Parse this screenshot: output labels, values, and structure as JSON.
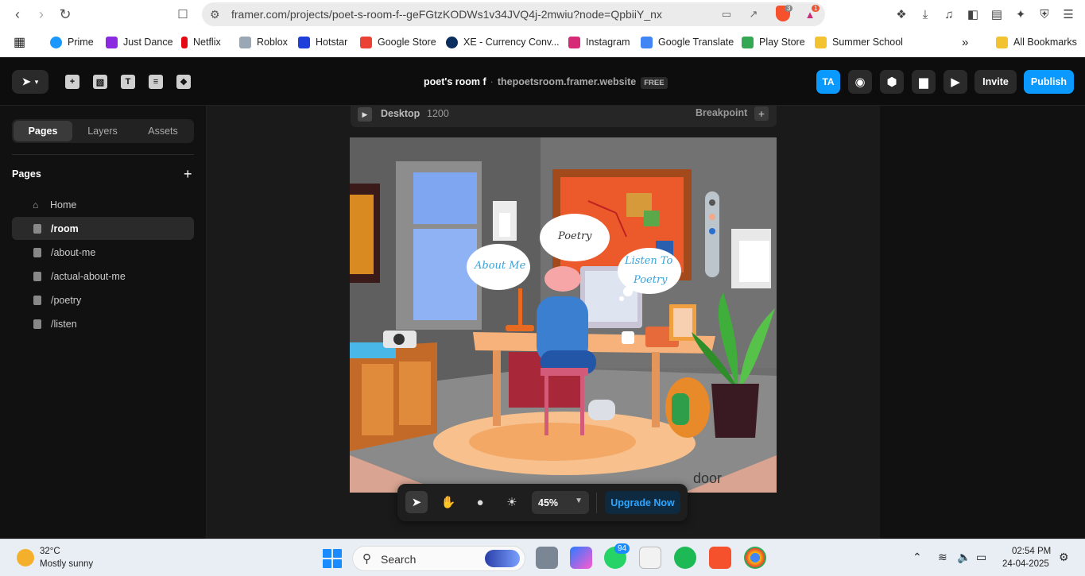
{
  "browser": {
    "url": "framer.com/projects/poet-s-room-f--geFGtzKODWs1v34JVQ4j-2mwiu?node=QpbiiY_nx",
    "brave_badge": "3",
    "alert_badge": "1",
    "bookmarks": [
      {
        "label": "Prime",
        "color": "#1a98ff"
      },
      {
        "label": "Just Dance",
        "color": "#8a2be2"
      },
      {
        "label": "Netflix",
        "color": "#e50914"
      },
      {
        "label": "Roblox",
        "color": "#9aa7b5"
      },
      {
        "label": "Hotstar",
        "color": "#1f3fdb"
      },
      {
        "label": "Google Store",
        "color": "#ea4335"
      },
      {
        "label": "XE - Currency Conv...",
        "color": "#0b2e5f"
      },
      {
        "label": "Instagram",
        "color": "#d62976"
      },
      {
        "label": "Google Translate",
        "color": "#4285f4"
      },
      {
        "label": "Play Store",
        "color": "#34a853"
      },
      {
        "label": "Summer School",
        "color": "#f2c230"
      }
    ],
    "all_bookmarks": "All Bookmarks"
  },
  "framer": {
    "project_name": "poet's room f",
    "site": "thepoetsroom.framer.website",
    "plan": "FREE",
    "avatar": "TA",
    "invite": "Invite",
    "publish": "Publish"
  },
  "left_panel": {
    "tabs": [
      "Pages",
      "Layers",
      "Assets"
    ],
    "active_tab": "Pages",
    "heading": "Pages",
    "pages": [
      {
        "label": "Home",
        "icon": "home-icon"
      },
      {
        "label": "/room",
        "icon": "page-icon"
      },
      {
        "label": "/about-me",
        "icon": "page-icon"
      },
      {
        "label": "/actual-about-me",
        "icon": "page-icon"
      },
      {
        "label": "/poetry",
        "icon": "page-icon"
      },
      {
        "label": "/listen",
        "icon": "page-icon"
      }
    ],
    "active_page": "/room"
  },
  "canvas": {
    "breakpoint_label": "Desktop",
    "breakpoint_width": "1200",
    "breakpoint_button": "Breakpoint",
    "bubbles": {
      "about": "About Me",
      "poetry": "Poetry",
      "listen_1": "Listen To",
      "listen_2": "Poetry"
    },
    "door_label": "door"
  },
  "bottom_toolbar": {
    "zoom": "45%",
    "upgrade": "Upgrade Now"
  },
  "taskbar": {
    "temperature": "32°C",
    "weather": "Mostly sunny",
    "search": "Search",
    "whatsapp_badge": "94",
    "time": "02:54 PM",
    "date": "24-04-2025"
  }
}
